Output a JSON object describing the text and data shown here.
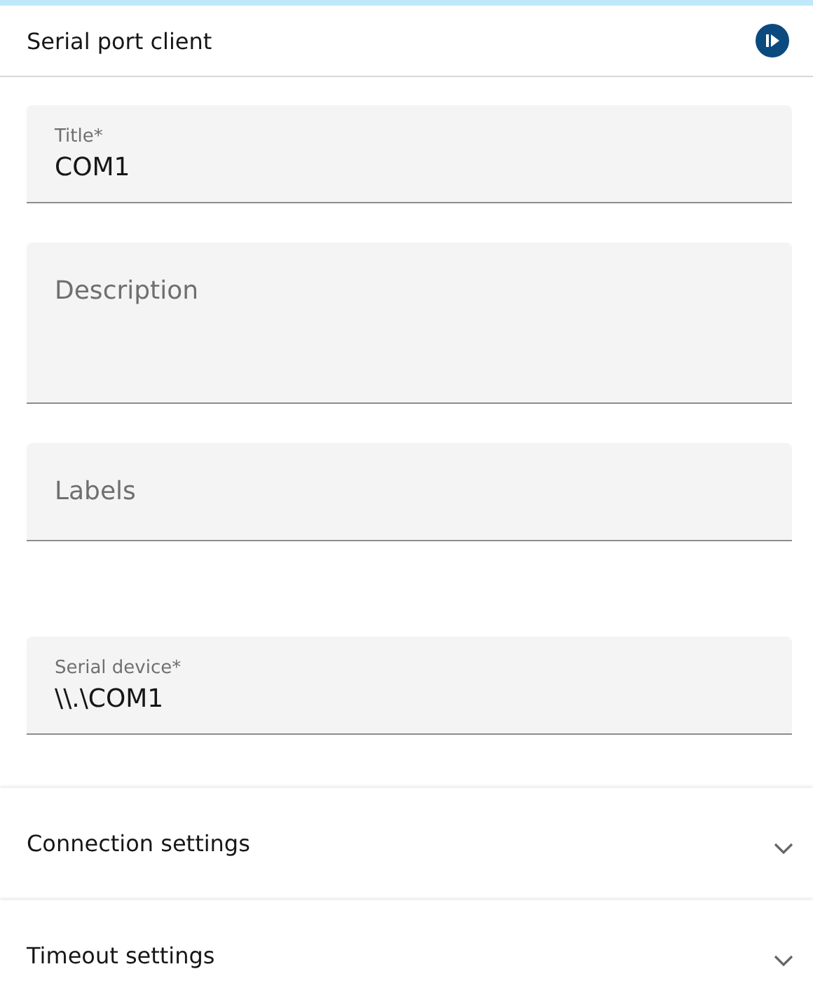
{
  "header": {
    "title": "Serial port client"
  },
  "fields": [
    {
      "kind": "input",
      "label": "Title*",
      "value": "COM1"
    },
    {
      "kind": "textarea",
      "placeholder": "Description"
    },
    {
      "kind": "input",
      "placeholder": "Labels"
    },
    {
      "kind": "input",
      "label": "Serial device*",
      "value": "\\\\.\\COM1"
    }
  ],
  "sections": [
    {
      "title": "Connection settings",
      "expanded": false
    },
    {
      "title": "Timeout settings",
      "expanded": false
    }
  ]
}
